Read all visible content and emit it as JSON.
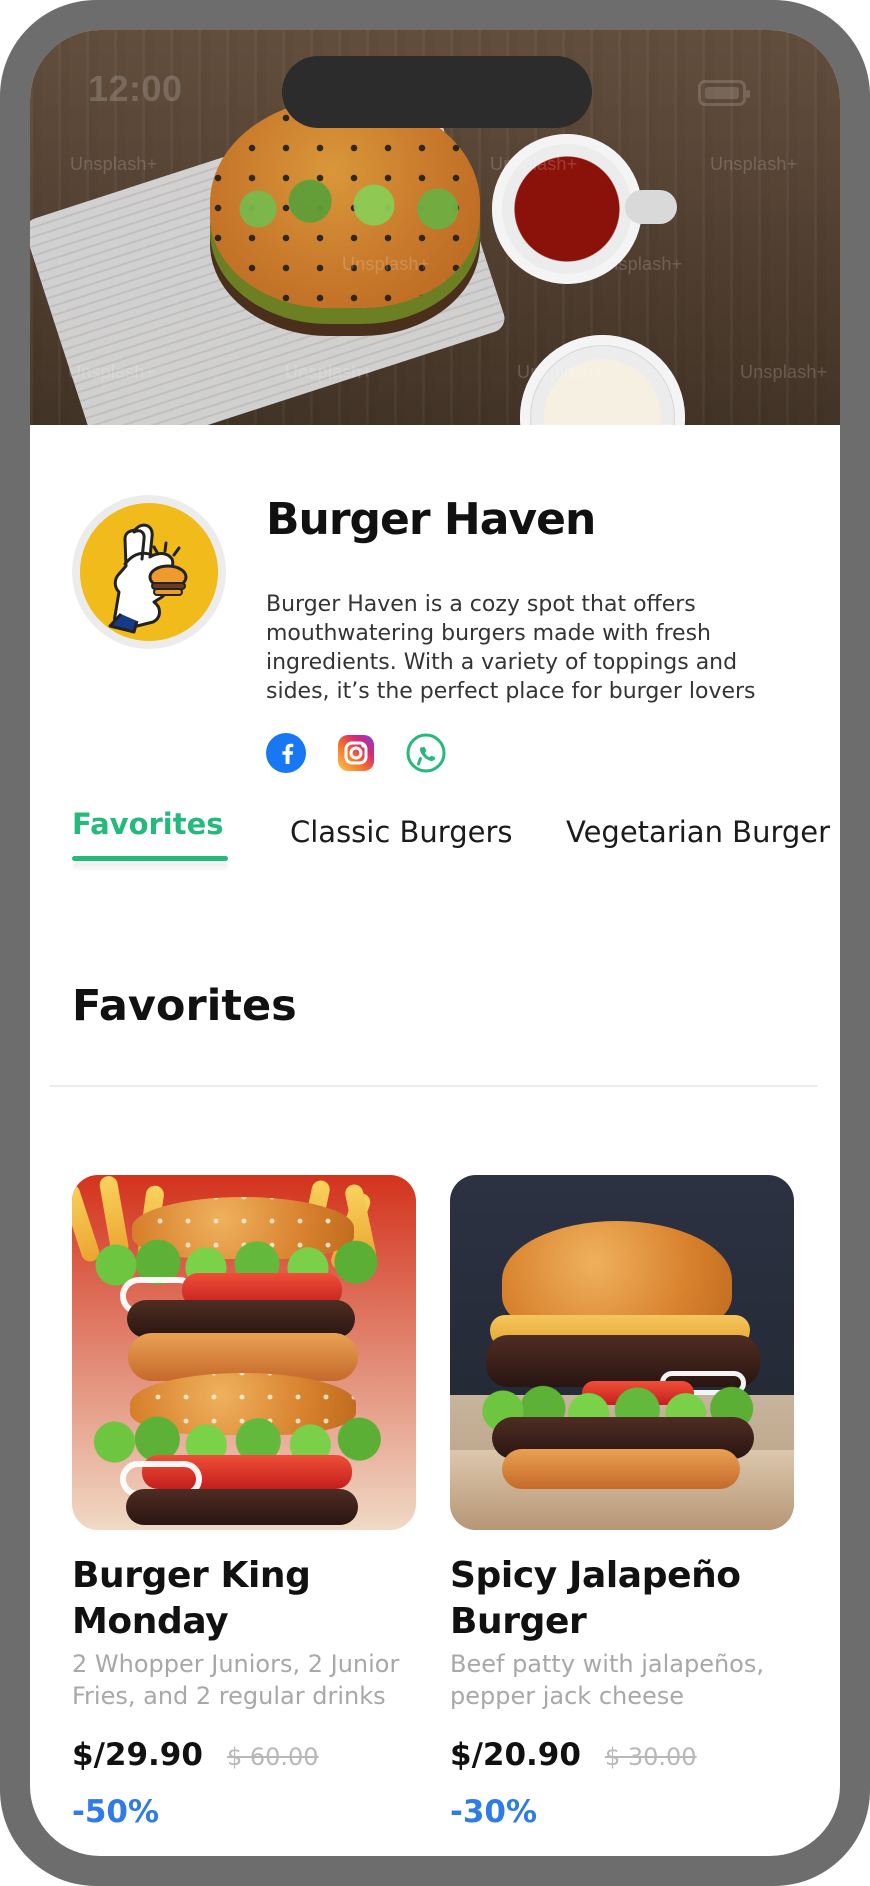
{
  "status": {
    "time": "12:00"
  },
  "hero": {
    "watermarks": [
      "Unsplash+",
      "Unsplash+",
      "Unsplash+",
      "Unsplash+",
      "Unsplash+",
      "Unsplash+",
      "Unsplash+",
      "Unsplash+",
      "Unsplash+"
    ]
  },
  "restaurant": {
    "name": "Burger Haven",
    "description": "Burger Haven is a cozy spot that offers mouthwatering burgers made with fresh ingredients. With a variety of toppings and sides, it’s the perfect place for burger lovers"
  },
  "social": {
    "items": [
      {
        "icon": "facebook-icon"
      },
      {
        "icon": "instagram-icon"
      },
      {
        "icon": "whatsapp-icon"
      }
    ]
  },
  "tabs": [
    {
      "label": "Favorites"
    },
    {
      "label": "Classic Burgers"
    },
    {
      "label": "Vegetarian Burger"
    }
  ],
  "section": {
    "title": "Favorites"
  },
  "products": [
    {
      "name": "Burger King Monday",
      "description": "2 Whopper Juniors, 2 Junior Fries, and 2 regular drinks",
      "price": "$/29.90",
      "old_price": "$ 60.00",
      "discount": "-50%"
    },
    {
      "name": "Spicy Jalapeño Burger",
      "description": "Beef patty with jalapeños, pepper jack cheese",
      "price": "$/20.90",
      "old_price": "$ 30.00",
      "discount": "-30%"
    }
  ],
  "colors": {
    "accent_green": "#25B97C",
    "discount_blue": "#2F7BE8",
    "logo_yellow": "#F1BB1B"
  }
}
